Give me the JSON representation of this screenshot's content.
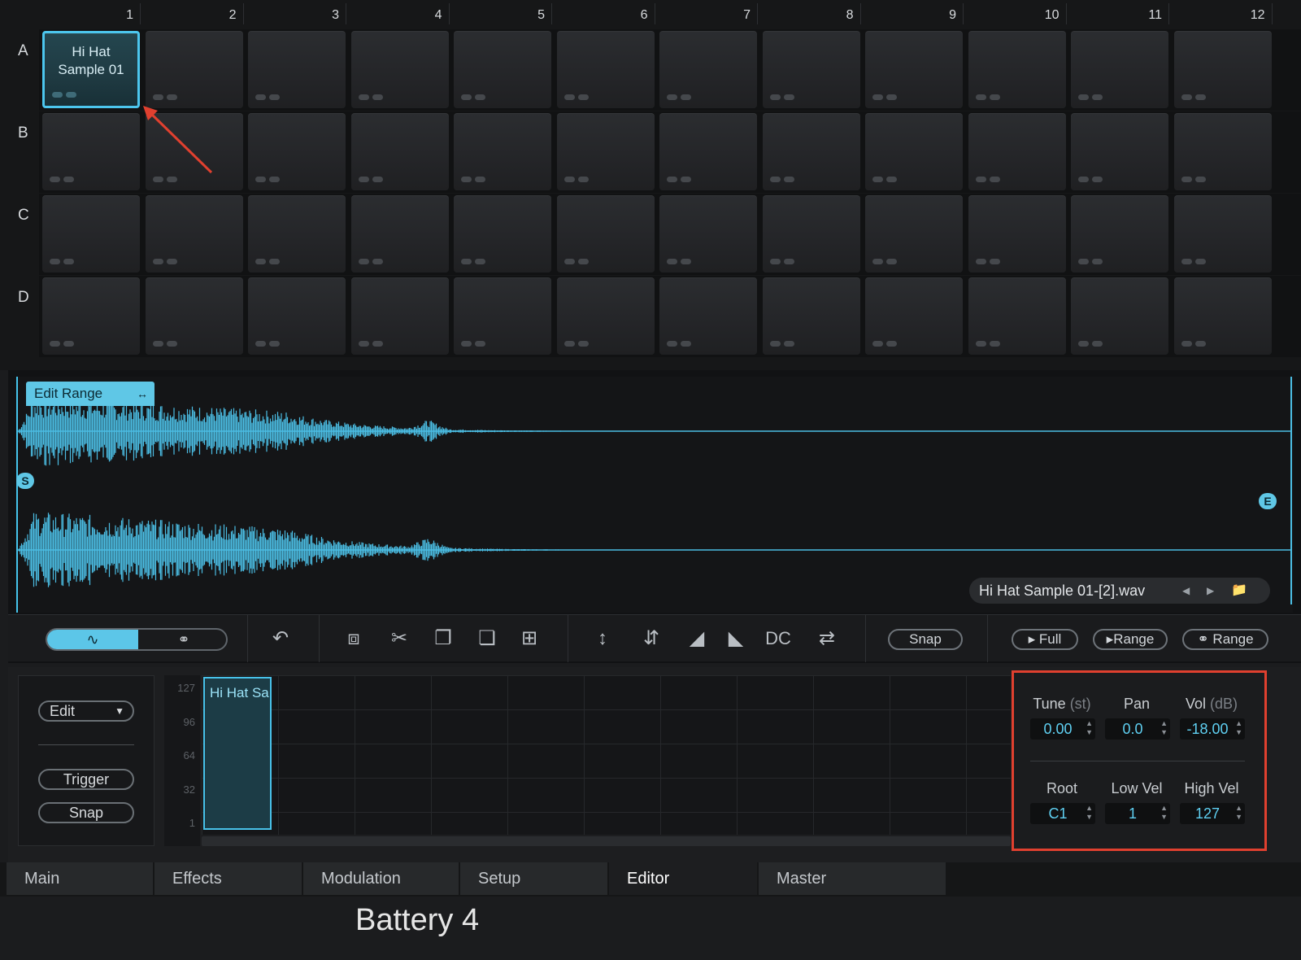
{
  "grid": {
    "columns": [
      "1",
      "2",
      "3",
      "4",
      "5",
      "6",
      "7",
      "8",
      "9",
      "10",
      "11",
      "12"
    ],
    "rows": [
      "A",
      "B",
      "C",
      "D"
    ],
    "selected_pad": {
      "row": "A",
      "column": "1",
      "label_line1": "Hi Hat",
      "label_line2": "Sample 01"
    }
  },
  "waveform": {
    "edit_range_label": "Edit Range",
    "edit_range_icon": "double-arrow-icon",
    "start_marker": "S",
    "end_marker": "E",
    "filename": "Hi Hat Sample 01-[2].wav",
    "waveform_color": "#4bbde3"
  },
  "toolbar": {
    "dc_label": "DC",
    "snap_label": "Snap",
    "play_full_label": "Full",
    "play_range_label": "Range",
    "loop_range_label": "Range"
  },
  "mapping": {
    "edit_select": "Edit",
    "trigger_label": "Trigger",
    "snap_label": "Snap",
    "velocity_ticks": [
      "127",
      "96",
      "64",
      "32",
      "1"
    ],
    "zone_label": "Hi Hat Sa",
    "params": {
      "tune_label": "Tune",
      "tune_unit": "(st)",
      "tune_value": "0.00",
      "pan_label": "Pan",
      "pan_value": "0.0",
      "vol_label": "Vol",
      "vol_unit": "(dB)",
      "vol_value": "-18.00",
      "root_label": "Root",
      "root_value": "C1",
      "lowvel_label": "Low Vel",
      "lowvel_value": "1",
      "highvel_label": "High Vel",
      "highvel_value": "127"
    }
  },
  "tabs": [
    "Main",
    "Effects",
    "Modulation",
    "Setup",
    "Editor",
    "Master"
  ],
  "active_tab": "Editor",
  "caption": "Battery 4",
  "colors": {
    "accent": "#4cc6ee",
    "annotation": "#e0402f"
  }
}
